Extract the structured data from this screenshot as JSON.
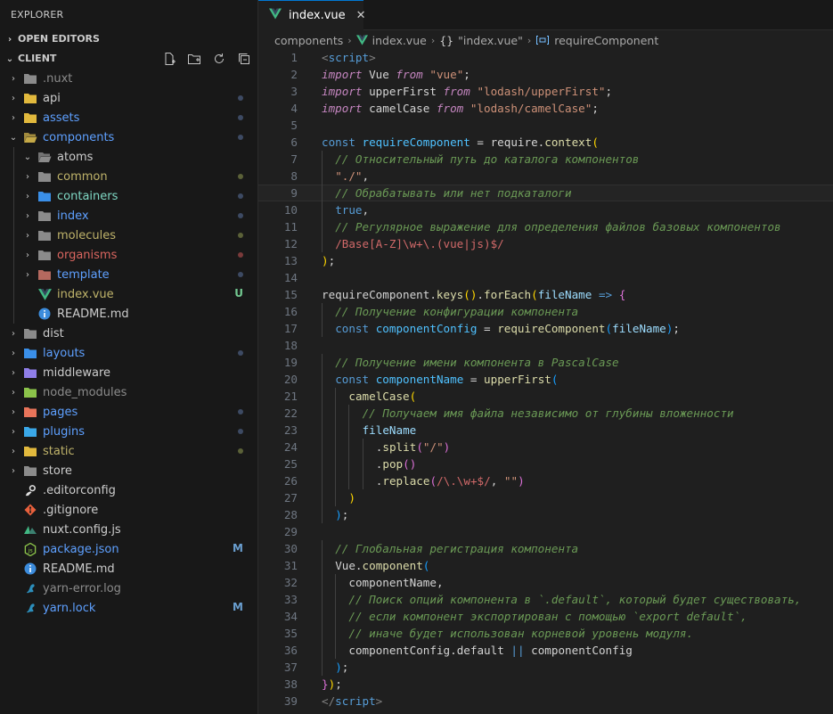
{
  "explorer": {
    "title": "EXPLORER",
    "open_editors": "OPEN EDITORS",
    "project": "CLIENT",
    "tree": [
      {
        "name": ".nuxt",
        "indent": 0,
        "kind": "folder",
        "twisty": "›",
        "color": "#8b8b8b",
        "icon": "folder-icon",
        "iconColor": "#8b8b8b"
      },
      {
        "name": "api",
        "indent": 0,
        "kind": "folder",
        "twisty": "›",
        "color": "#cccccc",
        "icon": "folder-icon",
        "iconColor": "#e2b93d",
        "dot": "#3d4a63"
      },
      {
        "name": "assets",
        "indent": 0,
        "kind": "folder",
        "twisty": "›",
        "color": "#5ea0ff",
        "icon": "folder-icon",
        "iconColor": "#e2b93d",
        "dot": "#3d4a63"
      },
      {
        "name": "components",
        "indent": 0,
        "kind": "folder-open",
        "twisty": "⌄",
        "color": "#5ea0ff",
        "icon": "folder-open-icon",
        "iconColor": "#c5a947",
        "dot": "#3d4a63"
      },
      {
        "name": "atoms",
        "indent": 1,
        "kind": "folder-open",
        "twisty": "⌄",
        "color": "#cccccc",
        "icon": "folder-open-icon",
        "iconColor": "#8b8b8b"
      },
      {
        "name": "common",
        "indent": 1,
        "kind": "folder",
        "twisty": "›",
        "color": "#bfb36a",
        "icon": "folder-icon",
        "iconColor": "#8b8b8b",
        "dot": "#5b6138"
      },
      {
        "name": "containers",
        "indent": 1,
        "kind": "folder",
        "twisty": "›",
        "color": "#7fd8c4",
        "icon": "folder-icon",
        "iconColor": "#3a8fe8",
        "dot": "#3d4a63"
      },
      {
        "name": "index",
        "indent": 1,
        "kind": "folder",
        "twisty": "›",
        "color": "#5ea0ff",
        "icon": "folder-icon",
        "iconColor": "#8b8b8b",
        "dot": "#3d4a63"
      },
      {
        "name": "molecules",
        "indent": 1,
        "kind": "folder",
        "twisty": "›",
        "color": "#bfb36a",
        "icon": "folder-icon",
        "iconColor": "#8b8b8b",
        "dot": "#5b6138"
      },
      {
        "name": "organisms",
        "indent": 1,
        "kind": "folder",
        "twisty": "›",
        "color": "#d9655f",
        "icon": "folder-icon",
        "iconColor": "#8b8b8b",
        "dot": "#7a3a3a"
      },
      {
        "name": "template",
        "indent": 1,
        "kind": "folder",
        "twisty": "›",
        "color": "#5ea0ff",
        "icon": "folder-icon",
        "iconColor": "#b5695f",
        "dot": "#3d4a63"
      },
      {
        "name": "index.vue",
        "indent": 1,
        "kind": "vue",
        "twisty": "",
        "color": "#bfb36a",
        "icon": "vue-icon",
        "iconColor": "#41b883",
        "badge": "U",
        "badgeColor": "#73c991"
      },
      {
        "name": "README.md",
        "indent": 1,
        "kind": "info",
        "twisty": "",
        "color": "#cccccc",
        "icon": "info-icon",
        "iconColor": "#3c8cdc"
      },
      {
        "name": "dist",
        "indent": 0,
        "kind": "folder",
        "twisty": "›",
        "color": "#cccccc",
        "icon": "folder-icon",
        "iconColor": "#8b8b8b"
      },
      {
        "name": "layouts",
        "indent": 0,
        "kind": "folder",
        "twisty": "›",
        "color": "#5ea0ff",
        "icon": "folder-icon",
        "iconColor": "#3a8fe8",
        "dot": "#3d4a63"
      },
      {
        "name": "middleware",
        "indent": 0,
        "kind": "folder",
        "twisty": "›",
        "color": "#cccccc",
        "icon": "folder-icon",
        "iconColor": "#8f7ee8"
      },
      {
        "name": "node_modules",
        "indent": 0,
        "kind": "folder",
        "twisty": "›",
        "color": "#8b8b8b",
        "icon": "folder-icon",
        "iconColor": "#8bc34a"
      },
      {
        "name": "pages",
        "indent": 0,
        "kind": "folder",
        "twisty": "›",
        "color": "#5ea0ff",
        "icon": "folder-icon",
        "iconColor": "#e8745a",
        "dot": "#3d4a63"
      },
      {
        "name": "plugins",
        "indent": 0,
        "kind": "folder",
        "twisty": "›",
        "color": "#5ea0ff",
        "icon": "folder-icon",
        "iconColor": "#3aa8e8",
        "dot": "#3d4a63"
      },
      {
        "name": "static",
        "indent": 0,
        "kind": "folder",
        "twisty": "›",
        "color": "#bfb36a",
        "icon": "folder-icon",
        "iconColor": "#e2b93d",
        "dot": "#5b6138"
      },
      {
        "name": "store",
        "indent": 0,
        "kind": "folder",
        "twisty": "›",
        "color": "#cccccc",
        "icon": "folder-icon",
        "iconColor": "#8b8b8b"
      },
      {
        "name": ".editorconfig",
        "indent": 0,
        "kind": "gear",
        "twisty": "",
        "color": "#cccccc",
        "icon": "editorconfig-icon",
        "iconColor": "#e0e0e0"
      },
      {
        "name": ".gitignore",
        "indent": 0,
        "kind": "git",
        "twisty": "",
        "color": "#cccccc",
        "icon": "git-icon",
        "iconColor": "#e8603c"
      },
      {
        "name": "nuxt.config.js",
        "indent": 0,
        "kind": "nuxt",
        "twisty": "",
        "color": "#cccccc",
        "icon": "nuxt-icon",
        "iconColor": "#41b883"
      },
      {
        "name": "package.json",
        "indent": 0,
        "kind": "npm",
        "twisty": "",
        "color": "#5ea0ff",
        "icon": "nodejs-icon",
        "iconColor": "#8bc34a",
        "badge": "M",
        "badgeColor": "#6a9fd0"
      },
      {
        "name": "README.md",
        "indent": 0,
        "kind": "info",
        "twisty": "",
        "color": "#cccccc",
        "icon": "info-icon",
        "iconColor": "#3c8cdc"
      },
      {
        "name": "yarn-error.log",
        "indent": 0,
        "kind": "yarn",
        "twisty": "",
        "color": "#8b8b8b",
        "icon": "yarn-icon",
        "iconColor": "#2c8ebb"
      },
      {
        "name": "yarn.lock",
        "indent": 0,
        "kind": "yarn",
        "twisty": "",
        "color": "#5ea0ff",
        "icon": "yarn-icon",
        "iconColor": "#2c8ebb",
        "badge": "M",
        "badgeColor": "#6a9fd0"
      }
    ]
  },
  "tab": {
    "label": "index.vue",
    "close": "✕"
  },
  "breadcrumb": {
    "folder": "components",
    "file": "index.vue",
    "obj_icon": "{}",
    "obj": "\"index.vue\"",
    "symbol": "requireComponent"
  },
  "current_line": 9,
  "code_lines": [
    {
      "n": 1,
      "indent": 0,
      "t": [
        [
          "tag",
          "<"
        ],
        [
          "tagn",
          "script"
        ],
        [
          "tag",
          ">"
        ]
      ]
    },
    {
      "n": 2,
      "indent": 0,
      "t": [
        [
          "kwi",
          "import"
        ],
        [
          "plain",
          " Vue "
        ],
        [
          "kwi",
          "from"
        ],
        [
          "plain",
          " "
        ],
        [
          "str",
          "\"vue\""
        ],
        [
          "plain",
          ";"
        ]
      ]
    },
    {
      "n": 3,
      "indent": 0,
      "t": [
        [
          "kwi",
          "import"
        ],
        [
          "plain",
          " upperFirst "
        ],
        [
          "kwi",
          "from"
        ],
        [
          "plain",
          " "
        ],
        [
          "str",
          "\"lodash/upperFirst\""
        ],
        [
          "plain",
          ";"
        ]
      ]
    },
    {
      "n": 4,
      "indent": 0,
      "t": [
        [
          "kwi",
          "import"
        ],
        [
          "plain",
          " camelCase "
        ],
        [
          "kwi",
          "from"
        ],
        [
          "plain",
          " "
        ],
        [
          "str",
          "\"lodash/camelCase\""
        ],
        [
          "plain",
          ";"
        ]
      ]
    },
    {
      "n": 5,
      "indent": 0,
      "t": []
    },
    {
      "n": 6,
      "indent": 0,
      "t": [
        [
          "kw",
          "const"
        ],
        [
          "plain",
          " "
        ],
        [
          "cst",
          "requireComponent"
        ],
        [
          "plain",
          " = require."
        ],
        [
          "fn",
          "context"
        ],
        [
          "b1",
          "("
        ]
      ]
    },
    {
      "n": 7,
      "indent": 1,
      "t": [
        [
          "cmt",
          "// Относительный путь до каталога компонентов"
        ]
      ]
    },
    {
      "n": 8,
      "indent": 1,
      "t": [
        [
          "str",
          "\"./\""
        ],
        [
          "plain",
          ","
        ]
      ]
    },
    {
      "n": 9,
      "indent": 1,
      "t": [
        [
          "cmt",
          "// Обрабатывать или нет подкаталоги"
        ]
      ]
    },
    {
      "n": 10,
      "indent": 1,
      "t": [
        [
          "kw",
          "true"
        ],
        [
          "plain",
          ","
        ]
      ]
    },
    {
      "n": 11,
      "indent": 1,
      "t": [
        [
          "cmt",
          "// Регулярное выражение для определения файлов базовых компонентов"
        ]
      ]
    },
    {
      "n": 12,
      "indent": 1,
      "t": [
        [
          "rx",
          "/Base[A-Z]\\w+\\.(vue|js)$/"
        ]
      ]
    },
    {
      "n": 13,
      "indent": 0,
      "t": [
        [
          "b1",
          ")"
        ],
        [
          "plain",
          ";"
        ]
      ]
    },
    {
      "n": 14,
      "indent": 0,
      "t": []
    },
    {
      "n": 15,
      "indent": 0,
      "t": [
        [
          "plain",
          "requireComponent."
        ],
        [
          "fn",
          "keys"
        ],
        [
          "b1",
          "()"
        ],
        [
          "plain",
          "."
        ],
        [
          "fn",
          "forEach"
        ],
        [
          "b1",
          "("
        ],
        [
          "var",
          "fileName"
        ],
        [
          "plain",
          " "
        ],
        [
          "kw",
          "=>"
        ],
        [
          "plain",
          " "
        ],
        [
          "b2",
          "{"
        ]
      ]
    },
    {
      "n": 16,
      "indent": 1,
      "t": [
        [
          "cmt",
          "// Получение конфигурации компонента"
        ]
      ]
    },
    {
      "n": 17,
      "indent": 1,
      "t": [
        [
          "kw",
          "const"
        ],
        [
          "plain",
          " "
        ],
        [
          "cst",
          "componentConfig"
        ],
        [
          "plain",
          " = "
        ],
        [
          "fn",
          "requireComponent"
        ],
        [
          "b3",
          "("
        ],
        [
          "var",
          "fileName"
        ],
        [
          "b3",
          ")"
        ],
        [
          "plain",
          ";"
        ]
      ]
    },
    {
      "n": 18,
      "indent": 0,
      "t": []
    },
    {
      "n": 19,
      "indent": 1,
      "t": [
        [
          "cmt",
          "// Получение имени компонента в PascalCase"
        ]
      ]
    },
    {
      "n": 20,
      "indent": 1,
      "t": [
        [
          "kw",
          "const"
        ],
        [
          "plain",
          " "
        ],
        [
          "cst",
          "componentName"
        ],
        [
          "plain",
          " = "
        ],
        [
          "fn",
          "upperFirst"
        ],
        [
          "b3",
          "("
        ]
      ]
    },
    {
      "n": 21,
      "indent": 2,
      "t": [
        [
          "fn",
          "camelCase"
        ],
        [
          "b1",
          "("
        ]
      ]
    },
    {
      "n": 22,
      "indent": 3,
      "t": [
        [
          "cmt",
          "// Получаем имя файла независимо от глубины вложенности"
        ]
      ]
    },
    {
      "n": 23,
      "indent": 3,
      "t": [
        [
          "var",
          "fileName"
        ]
      ]
    },
    {
      "n": 24,
      "indent": 4,
      "t": [
        [
          "plain",
          "."
        ],
        [
          "fn",
          "split"
        ],
        [
          "b2",
          "("
        ],
        [
          "str",
          "\"/\""
        ],
        [
          "b2",
          ")"
        ]
      ]
    },
    {
      "n": 25,
      "indent": 4,
      "t": [
        [
          "plain",
          "."
        ],
        [
          "fn",
          "pop"
        ],
        [
          "b2",
          "()"
        ]
      ]
    },
    {
      "n": 26,
      "indent": 4,
      "t": [
        [
          "plain",
          "."
        ],
        [
          "fn",
          "replace"
        ],
        [
          "b2",
          "("
        ],
        [
          "rx",
          "/\\.\\w+$/"
        ],
        [
          "plain",
          ", "
        ],
        [
          "str",
          "\"\""
        ],
        [
          "b2",
          ")"
        ]
      ]
    },
    {
      "n": 27,
      "indent": 2,
      "t": [
        [
          "b1",
          ")"
        ]
      ]
    },
    {
      "n": 28,
      "indent": 1,
      "t": [
        [
          "b3",
          ")"
        ],
        [
          "plain",
          ";"
        ]
      ]
    },
    {
      "n": 29,
      "indent": 0,
      "t": []
    },
    {
      "n": 30,
      "indent": 1,
      "t": [
        [
          "cmt",
          "// Глобальная регистрация компонента"
        ]
      ]
    },
    {
      "n": 31,
      "indent": 1,
      "t": [
        [
          "plain",
          "Vue."
        ],
        [
          "fn",
          "component"
        ],
        [
          "b3",
          "("
        ]
      ]
    },
    {
      "n": 32,
      "indent": 2,
      "t": [
        [
          "plain",
          "componentName,"
        ]
      ]
    },
    {
      "n": 33,
      "indent": 2,
      "t": [
        [
          "cmt",
          "// Поиск опций компонента в `.default`, который будет существовать,"
        ]
      ]
    },
    {
      "n": 34,
      "indent": 2,
      "t": [
        [
          "cmt",
          "// если компонент экспортирован с помощью `export default`,"
        ]
      ]
    },
    {
      "n": 35,
      "indent": 2,
      "t": [
        [
          "cmt",
          "// иначе будет использован корневой уровень модуля."
        ]
      ]
    },
    {
      "n": 36,
      "indent": 2,
      "t": [
        [
          "plain",
          "componentConfig.default "
        ],
        [
          "kw",
          "||"
        ],
        [
          "plain",
          " componentConfig"
        ]
      ]
    },
    {
      "n": 37,
      "indent": 1,
      "t": [
        [
          "b3",
          ")"
        ],
        [
          "plain",
          ";"
        ]
      ]
    },
    {
      "n": 38,
      "indent": 0,
      "t": [
        [
          "b2",
          "}"
        ],
        [
          "b1",
          ")"
        ],
        [
          "plain",
          ";"
        ]
      ]
    },
    {
      "n": 39,
      "indent": 0,
      "t": [
        [
          "tag",
          "</"
        ],
        [
          "tagn",
          "script"
        ],
        [
          "tag",
          ">"
        ]
      ]
    }
  ]
}
